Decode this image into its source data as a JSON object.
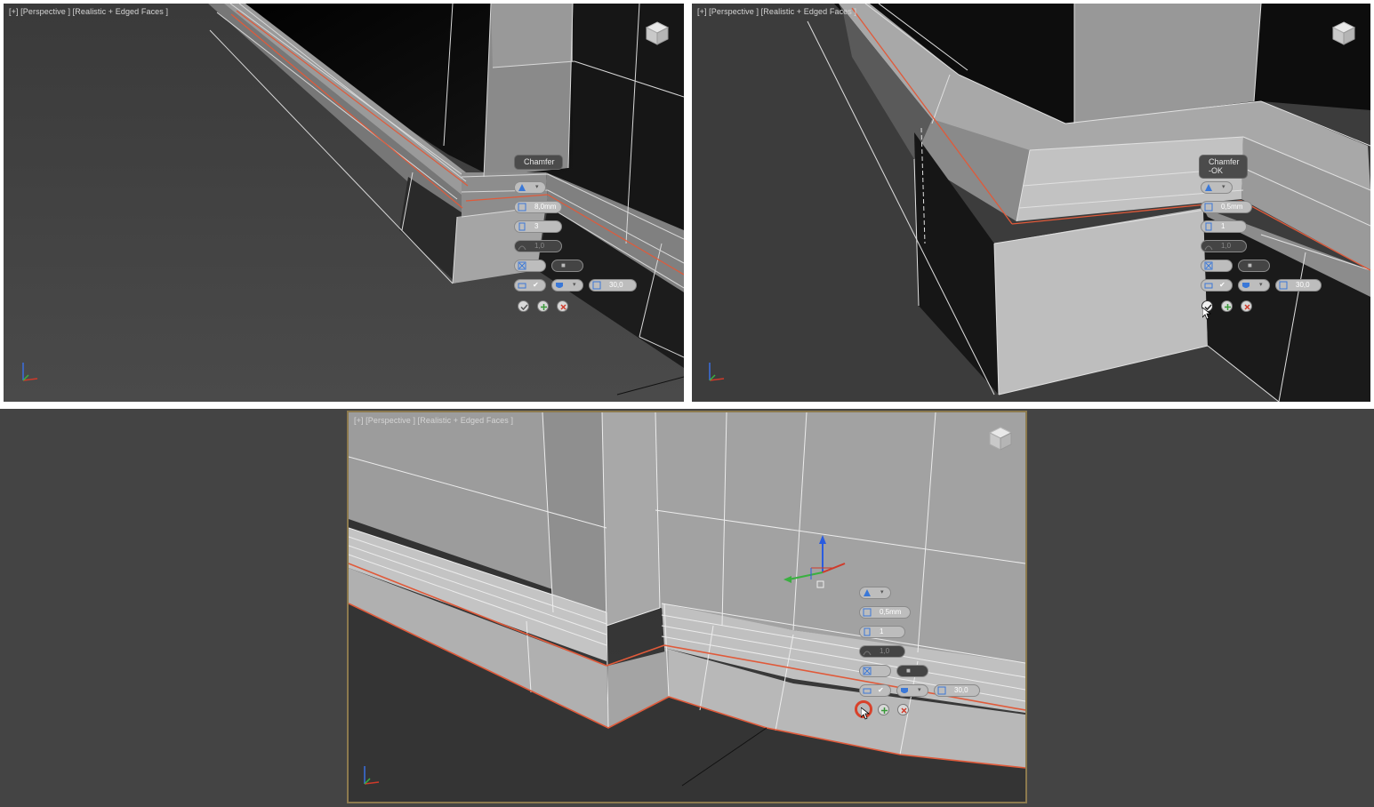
{
  "viewports": [
    {
      "label": "[+] [Perspective ] [Realistic + Edged Faces ]",
      "caddy": {
        "title": "Chamfer",
        "amount": "8,0mm",
        "segments": "3",
        "tension": "1,0",
        "smooth_threshold": "30,0",
        "buttons": [
          "ok-icon",
          "apply-icon",
          "cancel-icon"
        ]
      }
    },
    {
      "label": "[+] [Perspective ] [Realistic + Edged Faces ]",
      "caddy": {
        "title": "Chamfer\n-OK",
        "amount": "0,5mm",
        "segments": "1",
        "tension": "1,0",
        "smooth_threshold": "30,0",
        "buttons": [
          "ok-icon",
          "apply-icon",
          "cancel-icon"
        ]
      }
    },
    {
      "label": "[+] [Perspective ] [Realistic + Edged Faces ]",
      "caddy": {
        "amount": "0,5mm",
        "segments": "1",
        "tension": "1,0",
        "smooth_threshold": "30,0",
        "buttons": [
          "ok-icon",
          "apply-icon",
          "cancel-icon"
        ]
      }
    }
  ],
  "colors": {
    "viewport_border_active": "#8c7a4e",
    "selected_edge": "#e05a3a",
    "mesh_light": "#9a9a9a",
    "mesh_dark": "#161616"
  }
}
